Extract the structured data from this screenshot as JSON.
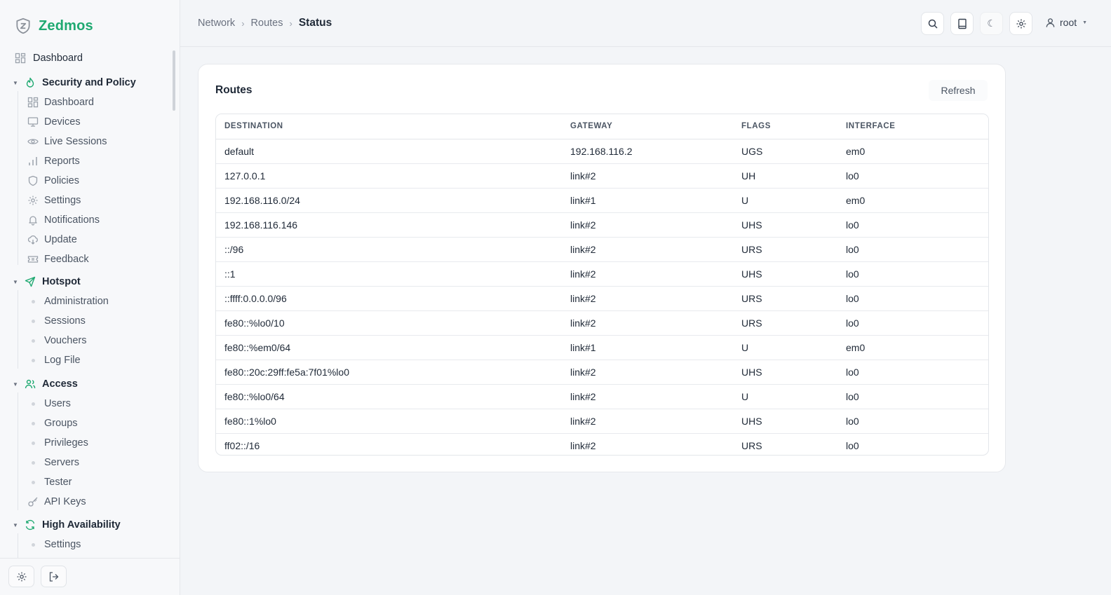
{
  "brand": {
    "name": "Zedmos",
    "accent": "#1fa971"
  },
  "sidebar": {
    "top": {
      "label": "Dashboard",
      "icon": "dashboard-icon"
    },
    "groups": [
      {
        "label": "Security and Policy",
        "icon": "flame-icon",
        "items": [
          {
            "label": "Dashboard",
            "icon": "dashboard-icon"
          },
          {
            "label": "Devices",
            "icon": "monitor-icon"
          },
          {
            "label": "Live Sessions",
            "icon": "eye-icon"
          },
          {
            "label": "Reports",
            "icon": "bar-chart-icon"
          },
          {
            "label": "Policies",
            "icon": "shield-icon"
          },
          {
            "label": "Settings",
            "icon": "gear-icon"
          },
          {
            "label": "Notifications",
            "icon": "bell-icon"
          },
          {
            "label": "Update",
            "icon": "cloud-download-icon"
          },
          {
            "label": "Feedback",
            "icon": "ticket-icon"
          }
        ]
      },
      {
        "label": "Hotspot",
        "icon": "send-icon",
        "items": [
          {
            "label": "Administration"
          },
          {
            "label": "Sessions"
          },
          {
            "label": "Vouchers"
          },
          {
            "label": "Log File"
          }
        ]
      },
      {
        "label": "Access",
        "icon": "users-icon",
        "items": [
          {
            "label": "Users"
          },
          {
            "label": "Groups"
          },
          {
            "label": "Privileges"
          },
          {
            "label": "Servers"
          },
          {
            "label": "Tester"
          },
          {
            "label": "API Keys",
            "icon": "key-icon"
          }
        ]
      },
      {
        "label": "High Availability",
        "icon": "refresh-icon",
        "items": [
          {
            "label": "Settings"
          }
        ]
      }
    ],
    "footer": {
      "settings_icon": "gear-icon",
      "logout_icon": "logout-icon"
    }
  },
  "header": {
    "breadcrumb": [
      "Network",
      "Routes",
      "Status"
    ],
    "user": "root",
    "icons": [
      "search-icon",
      "book-icon",
      "moon-icon",
      "gear-icon"
    ]
  },
  "card": {
    "title": "Routes",
    "refresh_label": "Refresh",
    "columns": [
      "DESTINATION",
      "GATEWAY",
      "FLAGS",
      "INTERFACE"
    ],
    "rows": [
      [
        "default",
        "192.168.116.2",
        "UGS",
        "em0"
      ],
      [
        "127.0.0.1",
        "link#2",
        "UH",
        "lo0"
      ],
      [
        "192.168.116.0/24",
        "link#1",
        "U",
        "em0"
      ],
      [
        "192.168.116.146",
        "link#2",
        "UHS",
        "lo0"
      ],
      [
        "::/96",
        "link#2",
        "URS",
        "lo0"
      ],
      [
        "::1",
        "link#2",
        "UHS",
        "lo0"
      ],
      [
        "::ffff:0.0.0.0/96",
        "link#2",
        "URS",
        "lo0"
      ],
      [
        "fe80::%lo0/10",
        "link#2",
        "URS",
        "lo0"
      ],
      [
        "fe80::%em0/64",
        "link#1",
        "U",
        "em0"
      ],
      [
        "fe80::20c:29ff:fe5a:7f01%lo0",
        "link#2",
        "UHS",
        "lo0"
      ],
      [
        "fe80::%lo0/64",
        "link#2",
        "U",
        "lo0"
      ],
      [
        "fe80::1%lo0",
        "link#2",
        "UHS",
        "lo0"
      ],
      [
        "ff02::/16",
        "link#2",
        "URS",
        "lo0"
      ]
    ]
  }
}
